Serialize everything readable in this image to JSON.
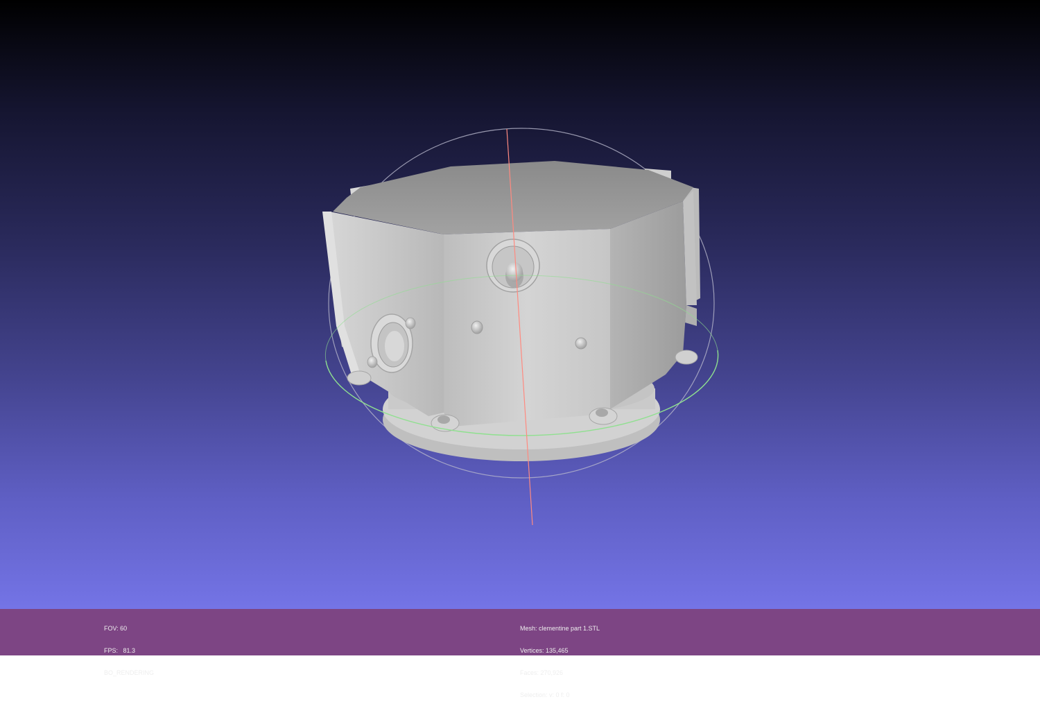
{
  "viewport": {
    "gradient_colors": [
      "#000000",
      "#2a2a5c",
      "#44448f",
      "#7474e6"
    ]
  },
  "status_bar": {
    "background": "#7d4584",
    "left": {
      "fov": "FOV: 60",
      "fps": "FPS:   81.3",
      "mode": "BO_RENDERING"
    },
    "right": {
      "mesh": "Mesh: clementine part 1.STL",
      "vertices": "Vertices: 135,465",
      "faces": "Faces: 270,926",
      "selection": "Selection: v: 0 f: 0"
    }
  },
  "trackball": {
    "colors": {
      "horizontal_ring": "#8fe08f",
      "vertical_axis": "#ff8a80",
      "outer_ring": "#b8b8cc"
    }
  },
  "model": {
    "color": "#c8c8c8"
  }
}
